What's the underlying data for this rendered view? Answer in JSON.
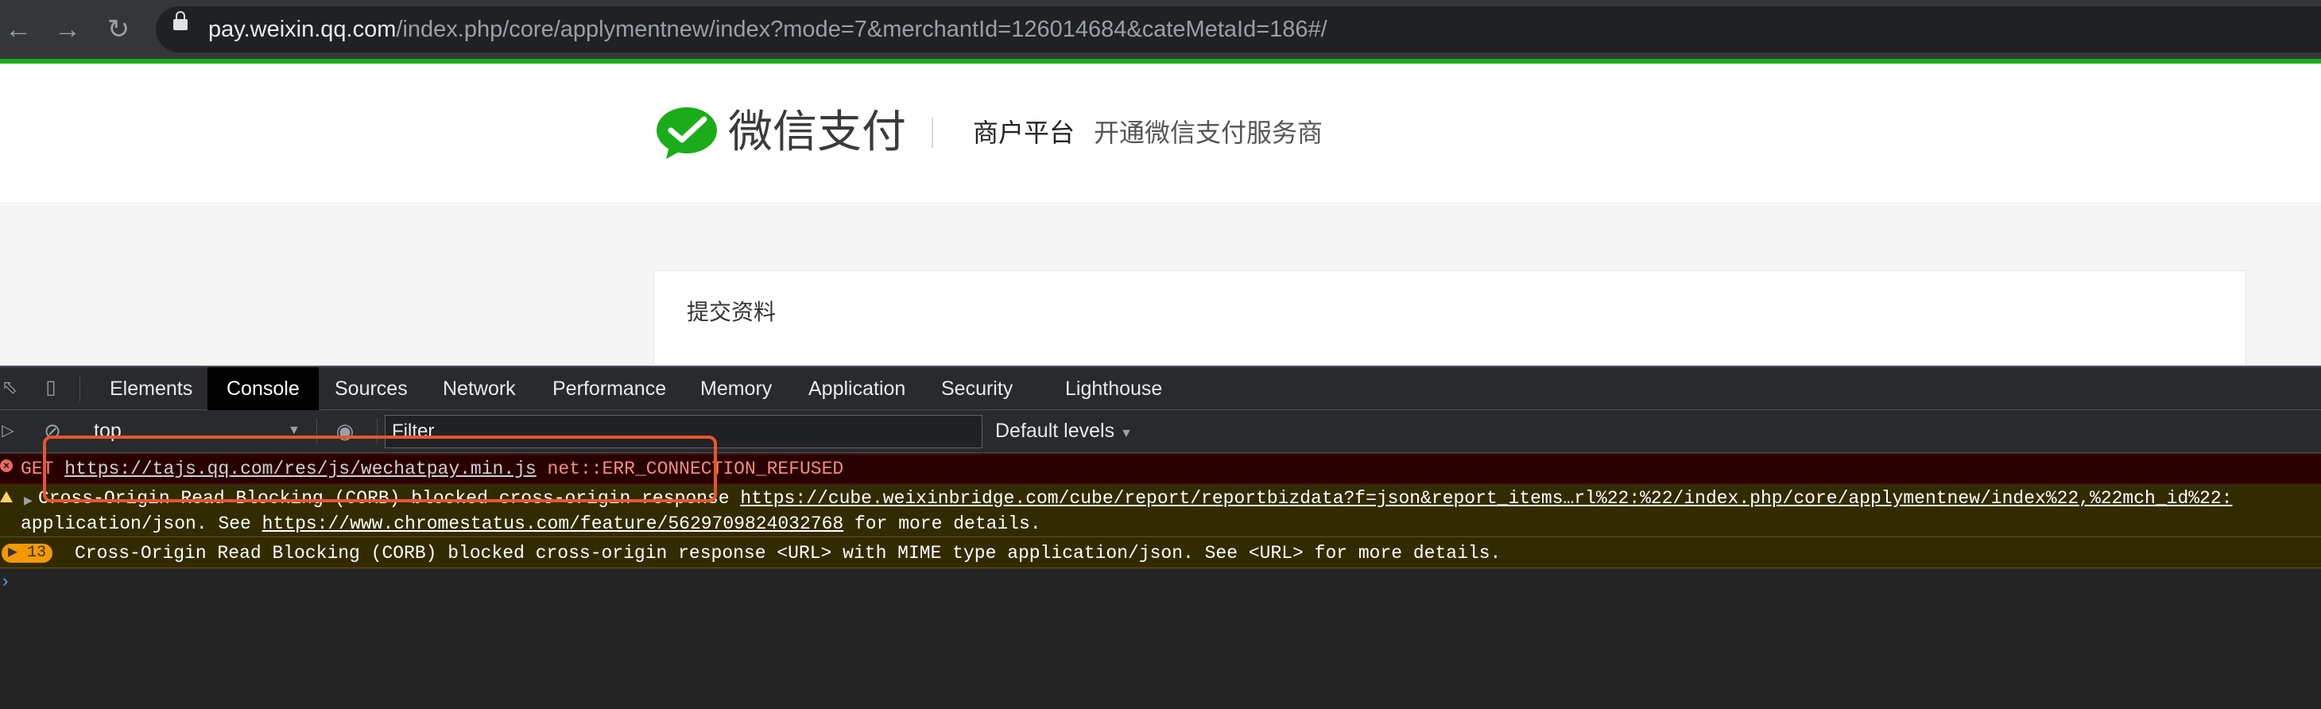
{
  "browser": {
    "url_host": "pay.weixin.qq.com",
    "url_path": "/index.php/core/applymentnew/index?mode=7&merchantId=126014684&cateMetaId=186#/",
    "nav_icons": [
      "back-arrow-icon",
      "forward-arrow-icon",
      "reload-icon",
      "lock-icon"
    ]
  },
  "page": {
    "brand": "微信支付",
    "merchant_platform": "商户平台",
    "subtitle": "开通微信支付服务商",
    "card_title": "提交资料",
    "brand_color": "#1aad19"
  },
  "devtools": {
    "tabs": [
      "Elements",
      "Console",
      "Sources",
      "Network",
      "Performance",
      "Memory",
      "Application",
      "Security",
      "Lighthouse"
    ],
    "active_tab": "Console",
    "context": "top",
    "filter_placeholder": "Filter",
    "levels": "Default levels",
    "console": {
      "error": {
        "method": "GET",
        "url": "https://tajs.qq.com/res/js/wechatpay.min.js",
        "message": "net::ERR_CONNECTION_REFUSED"
      },
      "warning": {
        "prefix": "Cross-Origin Read Blocking (CORB) blocked cross-origin response ",
        "url": "https://cube.weixinbridge.com/cube/report/reportbizdata?f=json&report_items…rl%22:%22/index.php/core/applymentnew/index%22,%22mch_id%22:",
        "line2_prefix": "application/json. See ",
        "link": "https://www.chromestatus.com/feature/5629709824032768",
        "line2_suffix": " for more details."
      },
      "grouped": {
        "count": "13",
        "message": "Cross-Origin Read Blocking (CORB) blocked cross-origin response <URL> with MIME type application/json. See <URL> for more details."
      }
    }
  }
}
